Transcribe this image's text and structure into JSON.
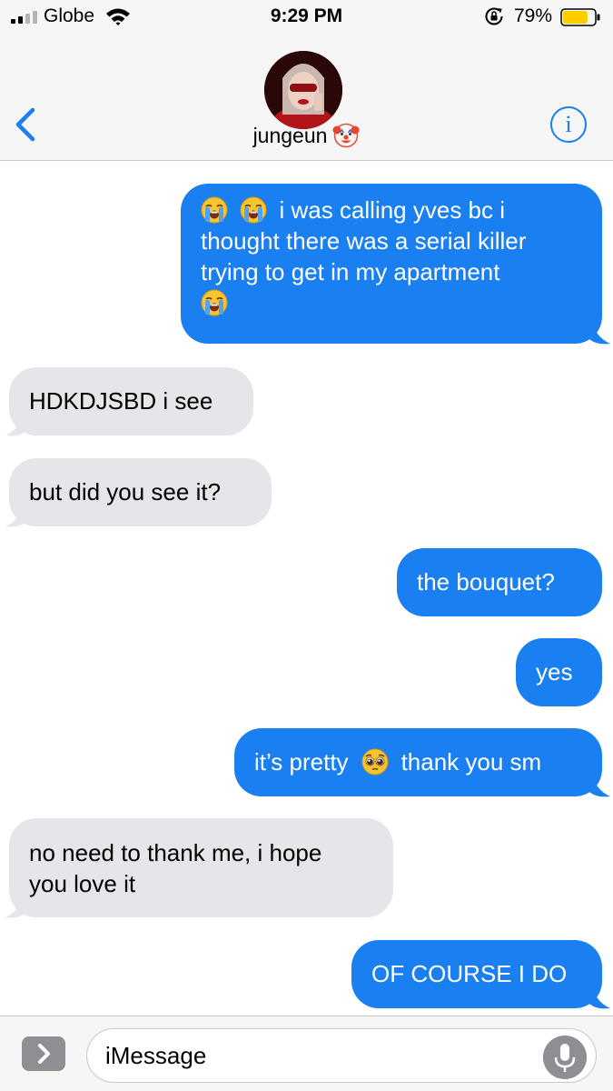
{
  "status_bar": {
    "carrier": "Globe",
    "time": "9:29 PM",
    "battery_percent": "79%",
    "battery_level": 0.79,
    "battery_color": "#ffcc00"
  },
  "header": {
    "back_icon": "chevron-left-icon",
    "contact_name": "jungeun",
    "name_emoji": "clown-face",
    "info_icon": "info-icon",
    "info_glyph": "i",
    "accent_color": "#1a7ff0"
  },
  "messages": [
    {
      "direction": "outgoing",
      "text_lines": [
        "i was calling yves bc i",
        "thought there was a serial killer",
        "trying to get in my apartment"
      ],
      "emojis": [
        "loudly-crying-face",
        "loudly-crying-face",
        "loudly-crying-face"
      ]
    },
    {
      "direction": "incoming",
      "text": "HDKDJSBD i see"
    },
    {
      "direction": "incoming",
      "text": "but did you see it?"
    },
    {
      "direction": "outgoing",
      "text": "the bouquet?"
    },
    {
      "direction": "outgoing",
      "text": "yes"
    },
    {
      "direction": "outgoing",
      "text_before": "it’s pretty",
      "emoji": "pleading-face",
      "text_after": "thank you sm"
    },
    {
      "direction": "incoming",
      "text_lines": [
        "no need to thank me, i hope",
        "you love it"
      ]
    },
    {
      "direction": "outgoing",
      "text": "OF COURSE I DO"
    }
  ],
  "colors": {
    "outgoing_bubble": "#1a7ff0",
    "incoming_bubble": "#e5e5ea"
  },
  "composer": {
    "placeholder": "iMessage",
    "expand_icon": "chevron-right-icon",
    "mic_icon": "microphone-icon"
  }
}
